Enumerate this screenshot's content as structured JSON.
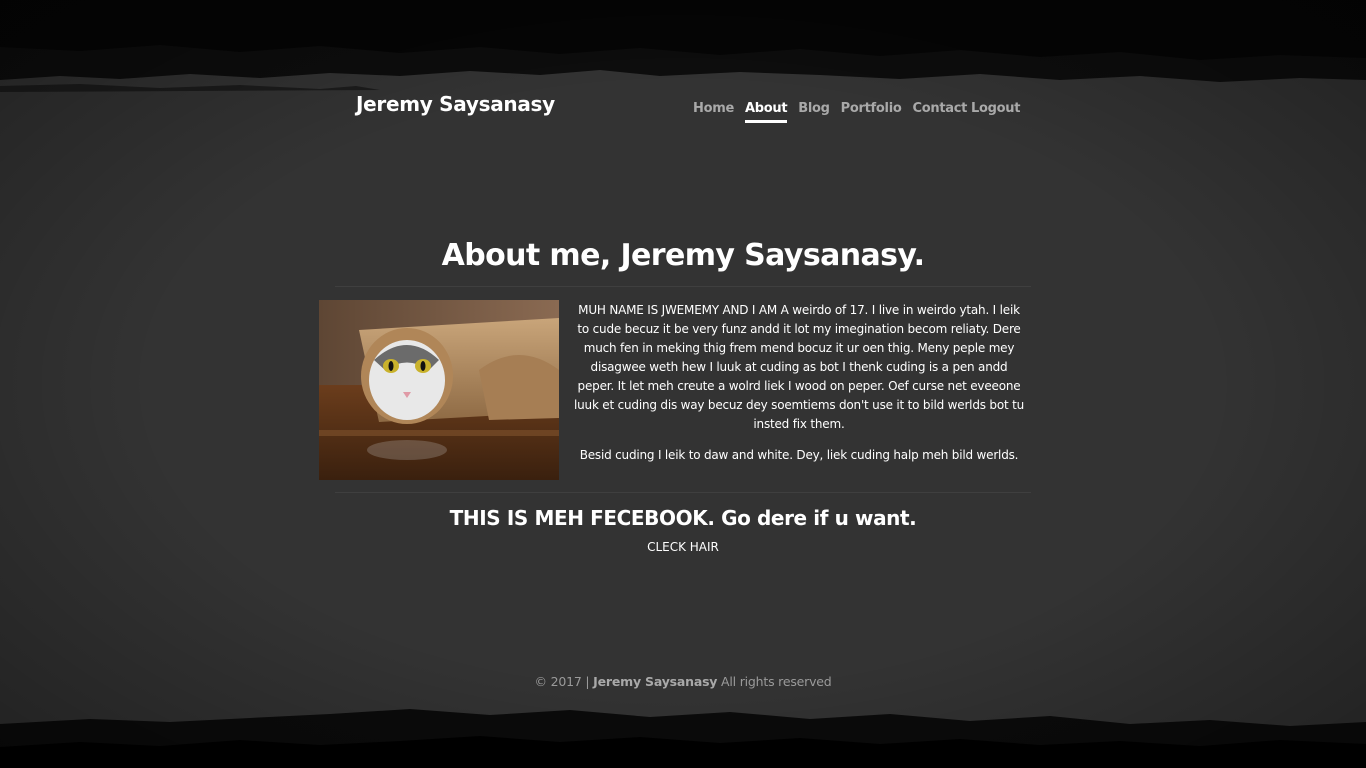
{
  "header": {
    "brand": "Jeremy Saysanasy",
    "nav": [
      {
        "label": "Home"
      },
      {
        "label": "About"
      },
      {
        "label": "Blog"
      },
      {
        "label": "Portfolio"
      },
      {
        "label": "Contact"
      },
      {
        "label": "Logout"
      }
    ],
    "active": "About"
  },
  "main": {
    "title": "About me, Jeremy Saysanasy.",
    "bio_paragraphs": [
      "MUH NAME IS JWEMEMY AND I AM A weirdo of 17. I live in weirdo ytah. I leik to cude becuz it be very funz andd it lot my imegination becom reliaty. Dere much fen in meking thig frem mend bocuz it ur oen thig. Meny peple mey disagwee weth hew I luuk at cuding as bot I thenk cuding is a pen andd peper. It let meh creute a wolrd liek I wood on peper. Oef curse net eveeone luuk et cuding dis way becuz dey soemtiems don't use it to bild werlds bot tu insted fix them.",
      "Besid cuding I leik to daw and white. Dey, liek cuding halp meh bild werlds."
    ],
    "photo_icon": "cat-in-paper-roll-photo",
    "facebook_heading": "THIS IS MEH FECEBOOK. Go dere if u want.",
    "facebook_link": "CLECK HAIR"
  },
  "footer": {
    "copyright": "© 2017 |",
    "owner": "Jeremy Saysanasy",
    "rights": "All rights reserved"
  },
  "colors": {
    "background": "#333333",
    "nav_inactive": "#a9a9a9",
    "nav_active": "#ffffff",
    "footer_text": "#9a9a9a"
  }
}
